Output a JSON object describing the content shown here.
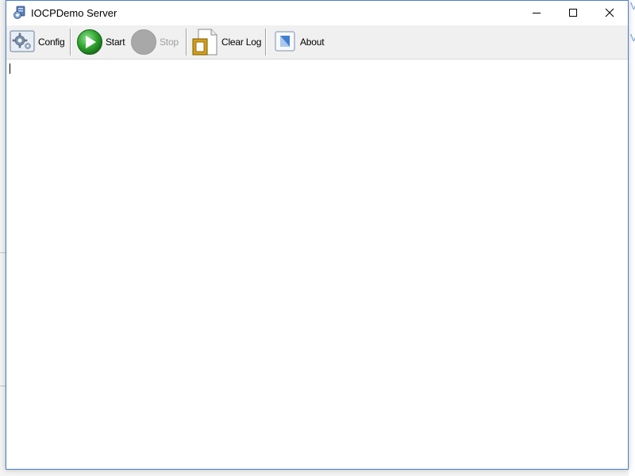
{
  "window": {
    "title": "IOCPDemo Server"
  },
  "toolbar": {
    "config_label": "Config",
    "start_label": "Start",
    "stop_label": "Stop",
    "clear_log_label": "Clear Log",
    "about_label": "About"
  },
  "icons": {
    "app": "server-gear-icon",
    "config": "config-gear-icon",
    "start": "play-icon",
    "stop": "stop-icon",
    "clear_log": "clear-log-icon",
    "about": "about-icon"
  },
  "log": {
    "content": ""
  },
  "colors": {
    "window_border": "#4a7fc9",
    "toolbar_bg": "#f0f0f0",
    "start_green": "#2fa52f",
    "stop_gray": "#a8a8a8",
    "disabled_text": "#a0a0a0"
  }
}
